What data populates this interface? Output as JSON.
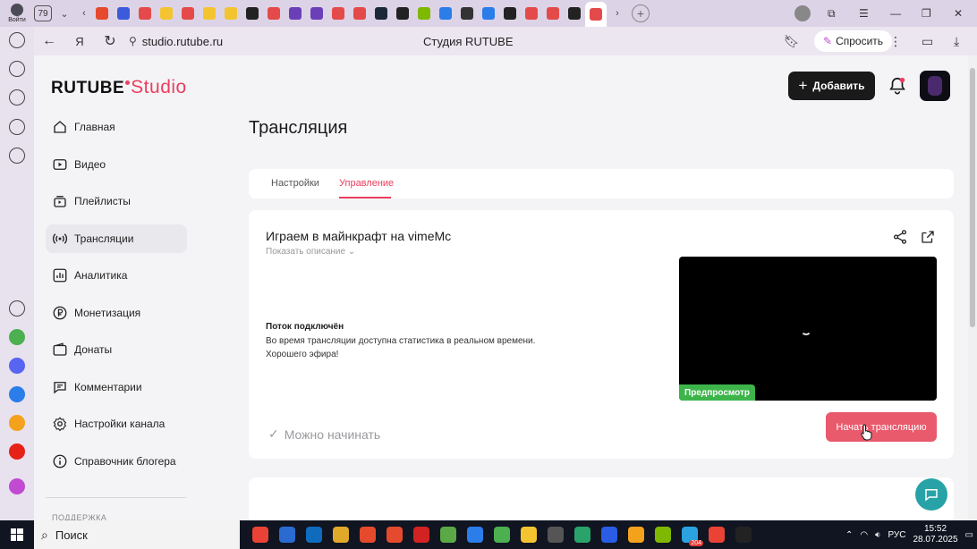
{
  "browser": {
    "profile_label": "Войти",
    "tab_count": "79",
    "url": "studio.rutube.ru",
    "page_title": "Студия RUTUBE",
    "ask_label": "Спросить",
    "tab_favicons": [
      "#e54a2c",
      "#3b5bdb",
      "#e54a4a",
      "#f4c430",
      "#e54a4a",
      "#f4c430",
      "#f4c430",
      "#222222",
      "#e54a4a",
      "#6b3fb8",
      "#6b3fb8",
      "#e54a4a",
      "#e54a4a",
      "#1b2838",
      "#222222",
      "#7fb800",
      "#2b7de9",
      "#333333",
      "#2b7de9",
      "#222222",
      "#e54a4a",
      "#e54a4a",
      "#222222",
      "#e54a4a"
    ],
    "rail_icons": [
      "history-icon",
      "bookmarks-icon",
      "play-icon",
      "tabs79-icon",
      "screenshot-icon",
      "plus-icon",
      "check-icon",
      "discord-icon",
      "mail-icon",
      "mailru-icon",
      "youtube-icon",
      "alice-icon"
    ]
  },
  "studio": {
    "logo_main": "RUTUBE",
    "logo_sub": "Studio",
    "add_button": "Добавить",
    "sidebar": [
      {
        "label": "Главная",
        "icon": "home-icon"
      },
      {
        "label": "Видео",
        "icon": "video-icon"
      },
      {
        "label": "Плейлисты",
        "icon": "playlist-icon"
      },
      {
        "label": "Трансляции",
        "icon": "broadcast-icon",
        "active": true
      },
      {
        "label": "Аналитика",
        "icon": "analytics-icon"
      },
      {
        "label": "Монетизация",
        "icon": "ruble-icon"
      },
      {
        "label": "Донаты",
        "icon": "wallet-icon"
      },
      {
        "label": "Комментарии",
        "icon": "comment-icon"
      },
      {
        "label": "Настройки канала",
        "icon": "settings-icon"
      },
      {
        "label": "Справочник блогера",
        "icon": "info-icon"
      }
    ],
    "sidebar_section": "ПОДДЕРЖКА",
    "page_heading": "Трансляция",
    "tabs": [
      {
        "label": "Настройки"
      },
      {
        "label": "Управление",
        "active": true
      }
    ],
    "stream": {
      "title": "Играем в майнкрафт на vimeMc",
      "show_description": "Показать описание",
      "status_title": "Поток подключён",
      "status_line1": "Во время трансляции доступна статистика в реальном времени.",
      "status_line2": "Хорошего эфира!",
      "preview_badge": "Предпросмотр",
      "ready_label": "Можно начинать",
      "start_button": "Начать трансляцию"
    },
    "accent_color": "#ec3e5f",
    "preview_badge_color": "#3db44a",
    "start_button_color": "#e85a6c"
  },
  "taskbar": {
    "search_placeholder": "Поиск",
    "apps": [
      "#ea4335",
      "#2a6bd1",
      "#0f6cbd",
      "#e1a92a",
      "#e54a2c",
      "#e54a2c",
      "#d32222",
      "#5ba846",
      "#2b7de9",
      "#4caf50",
      "#f4c430",
      "#555555",
      "#29a36a",
      "#2b5ce6",
      "#f4a11c",
      "#7fb800",
      "#2aa3e0",
      "#ea4335",
      "#222222"
    ],
    "telegram_badge": "204",
    "language": "РУС",
    "time": "15:52",
    "date": "28.07.2025"
  }
}
